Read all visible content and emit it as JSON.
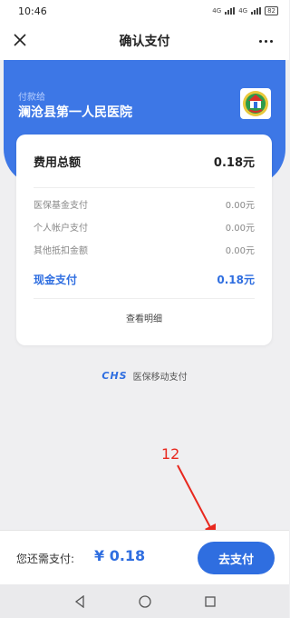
{
  "status_bar": {
    "time": "10:46",
    "signal_1_label": "4G",
    "signal_2_label": "4G",
    "battery": "82"
  },
  "nav": {
    "title": "确认支付",
    "close_icon": "close-icon",
    "more_icon": "more-icon"
  },
  "payee": {
    "label": "付款给",
    "name": "澜沧县第一人民医院"
  },
  "summary": {
    "total_label": "费用总额",
    "total_value": "0.18元",
    "items": [
      {
        "label": "医保基金支付",
        "value": "0.00元"
      },
      {
        "label": "个人帐户支付",
        "value": "0.00元"
      },
      {
        "label": "其他抵扣金额",
        "value": "0.00元"
      }
    ],
    "cash_label": "现金支付",
    "cash_value": "0.18元",
    "view_details": "查看明细"
  },
  "footer_brand": {
    "logo": "CHS",
    "text": "医保移动支付"
  },
  "annotation": {
    "number": "12"
  },
  "bottom": {
    "pay_label": "您还需支付:",
    "pay_amount": "¥ 0.18",
    "pay_button": "去支付"
  },
  "colors": {
    "brand_blue": "#3d77e6",
    "accent_blue": "#2f6ee0",
    "annotation_red": "#e8281e"
  }
}
